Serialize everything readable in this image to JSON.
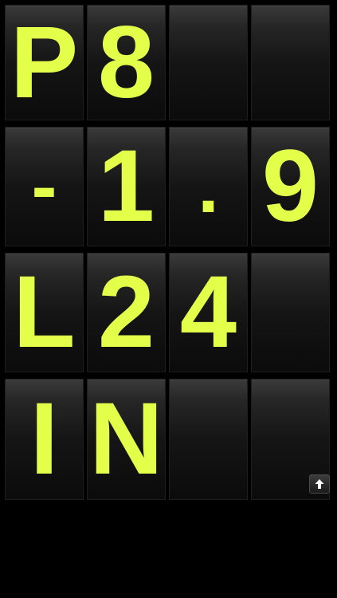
{
  "board": {
    "rows": [
      {
        "tiles": [
          "P",
          "8",
          "",
          ""
        ]
      },
      {
        "tiles": [
          "-",
          "1",
          ".",
          "9"
        ]
      },
      {
        "tiles": [
          "L",
          "2",
          "4",
          ""
        ]
      },
      {
        "tiles": [
          "I",
          "N",
          "",
          ""
        ]
      }
    ]
  },
  "colors": {
    "glyph": "#e4ff4a",
    "background": "#000000"
  },
  "controls": {
    "up_icon": "arrow-up-icon"
  }
}
